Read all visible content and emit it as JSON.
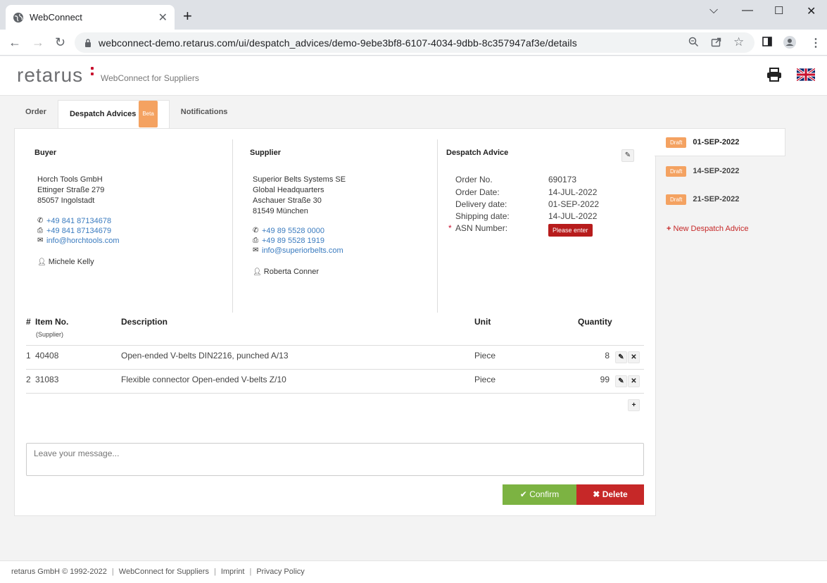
{
  "browser": {
    "tab_title": "WebConnect",
    "url": "webconnect-demo.retarus.com/ui/despatch_advices/demo-9ebe3bf8-6107-4034-9dbb-8c357947af3e/details"
  },
  "header": {
    "logo": "retarus",
    "subtitle": "WebConnect for Suppliers"
  },
  "tabs": [
    {
      "label": "Order"
    },
    {
      "label": "Despatch Advices",
      "badge": "Beta"
    },
    {
      "label": "Notifications"
    }
  ],
  "buyer": {
    "heading": "Buyer",
    "name": "Horch Tools GmbH",
    "street": "Ettinger Straße 279",
    "city": "85057 Ingolstadt",
    "phone": "+49 841 87134678",
    "fax": "+49 841 87134679",
    "email": "info@horchtools.com",
    "person": "Michele Kelly"
  },
  "supplier": {
    "heading": "Supplier",
    "name": "Superior Belts Systems SE",
    "line2": "Global Headquarters",
    "street": "Aschauer Straße 30",
    "city": "81549 München",
    "phone": "+49 89 5528 0000",
    "fax": "+49 89 5528 1919",
    "email": "info@superiorbelts.com",
    "person": "Roberta Conner"
  },
  "despatch": {
    "heading": "Despatch Advice",
    "fields": [
      {
        "label": "Order No.",
        "value": "690173"
      },
      {
        "label": "Order Date:",
        "value": "14-JUL-2022"
      },
      {
        "label": "Delivery date:",
        "value": "01-SEP-2022"
      },
      {
        "label": "Shipping date:",
        "value": "14-JUL-2022"
      },
      {
        "label": "ASN Number:",
        "required": "*"
      }
    ],
    "asn_button": "Please enter"
  },
  "items": {
    "headers": {
      "num": "#",
      "item_no": "Item No.",
      "item_no_sub": "(Supplier)",
      "description": "Description",
      "unit": "Unit",
      "quantity": "Quantity"
    },
    "rows": [
      {
        "num": "1",
        "item_no": "40408",
        "description": "Open-ended V-belts DIN2216, punched A/13",
        "unit": "Piece",
        "quantity": "8"
      },
      {
        "num": "2",
        "item_no": "31083",
        "description": "Flexible connector Open-ended V-belts Z/10",
        "unit": "Piece",
        "quantity": "99"
      }
    ]
  },
  "message": {
    "placeholder": "Leave your message..."
  },
  "actions": {
    "confirm": "Confirm",
    "delete": "Delete"
  },
  "sidebar": {
    "items": [
      {
        "badge": "Draft",
        "date": "01-SEP-2022"
      },
      {
        "badge": "Draft",
        "date": "14-SEP-2022"
      },
      {
        "badge": "Draft",
        "date": "21-SEP-2022"
      }
    ],
    "new_label": "New Despatch Advice"
  },
  "footer": {
    "copyright": "retarus GmbH © 1992-2022",
    "product": "WebConnect for Suppliers",
    "imprint": "Imprint",
    "privacy": "Privacy Policy"
  },
  "colors": {
    "accent_orange": "#f4a261",
    "confirm_green": "#7cb342",
    "delete_red": "#c62828",
    "link_blue": "#3a7bbf"
  }
}
